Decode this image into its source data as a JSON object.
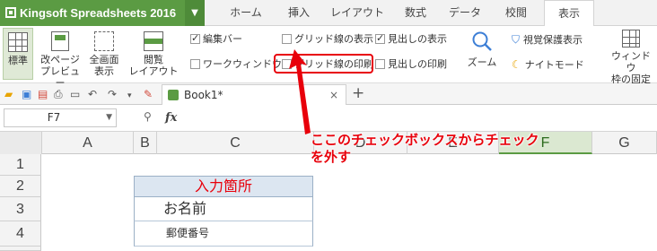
{
  "app": {
    "title": "Kingsoft Spreadsheets 2016"
  },
  "tabs": [
    {
      "label": "ホーム"
    },
    {
      "label": "挿入"
    },
    {
      "label": "レイアウト"
    },
    {
      "label": "数式"
    },
    {
      "label": "データ"
    },
    {
      "label": "校閲"
    },
    {
      "label": "表示",
      "active": true
    }
  ],
  "ribbon": {
    "view_buttons": [
      {
        "label": "標準",
        "selected": true
      },
      {
        "label_line1": "改ページ",
        "label_line2": "プレビュー"
      },
      {
        "label_line1": "全画面",
        "label_line2": "表示"
      },
      {
        "label_line1": "閲覧",
        "label_line2": "レイアウト"
      }
    ],
    "checkboxes": [
      {
        "label": "編集バー",
        "checked": true
      },
      {
        "label": "ワークウィンドウ",
        "checked": false
      },
      {
        "label": "グリッド線の表示",
        "checked": false
      },
      {
        "label": "グリッド線の印刷",
        "checked": false
      },
      {
        "label": "見出しの表示",
        "checked": true
      },
      {
        "label": "見出しの印刷",
        "checked": false
      }
    ],
    "zoom_label": "ズーム",
    "eye_protect_label": "視覚保護表示",
    "night_mode_label": "ナイトモード",
    "freeze_line1": "ウィンドウ",
    "freeze_line2": "枠の固定"
  },
  "document": {
    "tab_label": "Book1*"
  },
  "formula_bar": {
    "cell_ref": "F7",
    "fx_label": "fx"
  },
  "sheet": {
    "columns": [
      "A",
      "B",
      "C",
      "D",
      "E",
      "F",
      "G"
    ],
    "rows": [
      "1",
      "2",
      "3",
      "4"
    ],
    "cells": {
      "c2": "入力箇所",
      "c3": "お名前",
      "c4": "郵便番号"
    }
  },
  "annotation": {
    "line1": "ここのチェックボックスからチェック",
    "line2": "を外す"
  },
  "colors": {
    "accent": "#5b9b43",
    "annotation": "#e8000b"
  }
}
